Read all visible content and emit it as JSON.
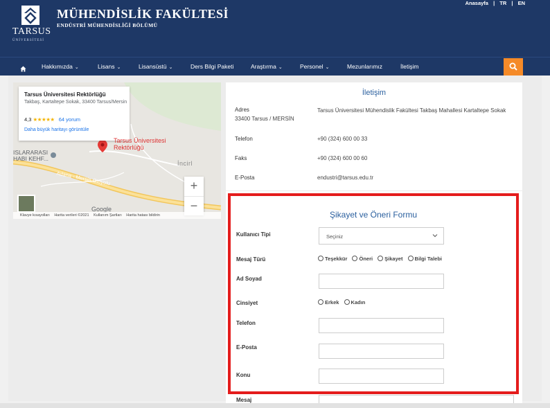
{
  "header": {
    "logo_text": "TARSUS",
    "logo_sub": "ÜNİVERSİTESİ",
    "faculty_title": "MÜHENDİSLİK FAKÜLTESİ",
    "department_title": "ENDÜSTRİ MÜHENDİSLİĞİ BÖLÜMÜ",
    "top_links": {
      "home": "Anasayfa",
      "sep": "|",
      "tr": "TR",
      "en": "EN"
    }
  },
  "nav": {
    "items": [
      {
        "label": "Hakkımızda",
        "chevron": "⌄"
      },
      {
        "label": "Lisans",
        "chevron": "⌄"
      },
      {
        "label": "Lisansüstü",
        "chevron": "⌄"
      },
      {
        "label": "Ders Bilgi Paketi",
        "chevron": ""
      },
      {
        "label": "Araştırma",
        "chevron": "⌄"
      },
      {
        "label": "Personel",
        "chevron": "⌄"
      },
      {
        "label": "Mezunlarımız",
        "chevron": ""
      },
      {
        "label": "İletişim",
        "chevron": ""
      }
    ],
    "search_icon": "search-icon",
    "accent_color": "#f58a28",
    "brand_color": "#1e3866"
  },
  "map": {
    "place_title": "Tarsus Üniversitesi Rektörlüğü",
    "address": "Takbaş, Kartaltepe Sokak, 33400 Tarsus/Mersin",
    "rating": "4,3",
    "stars": "★★★★★",
    "reviews": "64 yorum",
    "bigger_map_link": "Daha büyük haritayı görüntüle",
    "pin_label_line1": "Tarsus Üniversitesi",
    "pin_label_line2": "Rektörlüğü",
    "poi_label_line1": "ISLARARASI",
    "poi_label_line2": "HABI KEHF...",
    "town_label": "İncirl",
    "road_label": "Adana - Mersin Otoyolu",
    "zoom_in": "+",
    "zoom_out": "−",
    "google_logo": "Google",
    "footer": {
      "shortcuts": "Klavye kısayolları",
      "map_data": "Harita verileri ©2021",
      "terms": "Kullanım Şartları",
      "report": "Harita hatası bildirin"
    }
  },
  "contact": {
    "title": "İletişim",
    "address_label": "Adres",
    "address_value": "Tarsus Üniversitesi Mühendislik Fakültesi Takbaş Mahallesi Kartaltepe Sokak 33400 Tarsus / MERSİN",
    "phone_label": "Telefon",
    "phone_value": "+90 (324) 600 00 33",
    "fax_label": "Faks",
    "fax_value": "+90 (324) 600 00 60",
    "email_label": "E-Posta",
    "email_value": "endustri@tarsus.edu.tr"
  },
  "form": {
    "title": "Şikayet ve Öneri Formu",
    "user_type_label": "Kullanıcı Tipi",
    "user_type_value": "Seçiniz",
    "message_type_label": "Mesaj Türü",
    "message_type_options": [
      "Teşekkür",
      "Öneri",
      "Şikayet",
      "Bilgi Talebi"
    ],
    "name_label": "Ad Soyad",
    "gender_label": "Cinsiyet",
    "gender_options": [
      "Erkek",
      "Kadın"
    ],
    "phone_label": "Telefon",
    "email_label": "E-Posta",
    "subject_label": "Konu",
    "message_label": "Mesaj",
    "highlight_color": "#e41c1c"
  }
}
